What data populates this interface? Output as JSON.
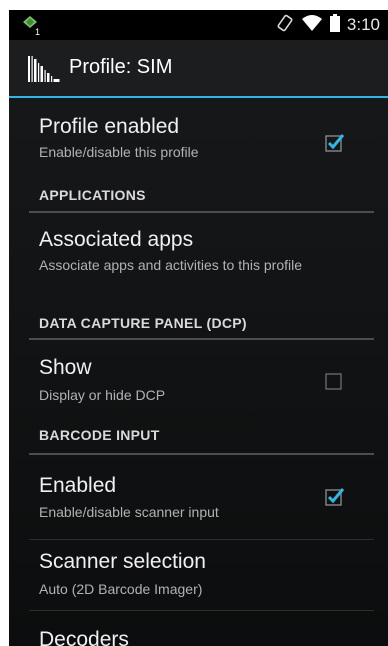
{
  "status_bar": {
    "time": "3:10",
    "icons": [
      "notification-icon",
      "rotate-icon",
      "wifi-icon",
      "battery-icon"
    ]
  },
  "action_bar": {
    "title": "Profile: SIM",
    "icon": "barcode-app-icon"
  },
  "colors": {
    "accent": "#33b5e5",
    "background": "#121415"
  },
  "preferences": {
    "profile_enabled": {
      "title": "Profile enabled",
      "summary": "Enable/disable this profile",
      "checked": true
    },
    "applications_header": "APPLICATIONS",
    "associated_apps": {
      "title": "Associated apps",
      "summary": "Associate apps and activities to this profile"
    },
    "dcp_header": "DATA CAPTURE PANEL (DCP)",
    "show": {
      "title": "Show",
      "summary": "Display or hide DCP",
      "checked": false
    },
    "barcode_header": "BARCODE INPUT",
    "enabled": {
      "title": "Enabled",
      "summary": "Enable/disable scanner input",
      "checked": true
    },
    "scanner_selection": {
      "title": "Scanner selection",
      "summary": "Auto (2D Barcode Imager)"
    },
    "decoders": {
      "title": "Decoders"
    }
  }
}
